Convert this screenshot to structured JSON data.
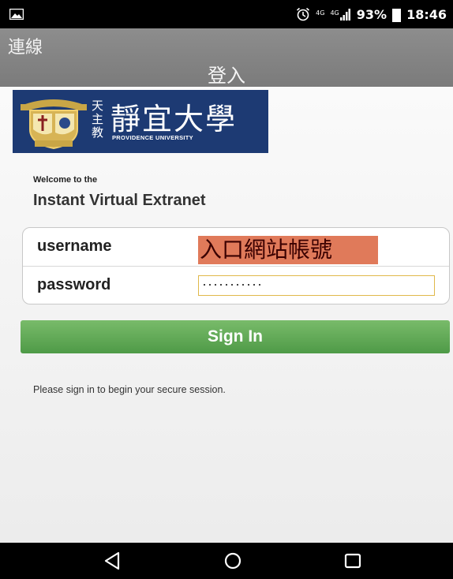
{
  "status_bar": {
    "network_1": "4G",
    "network_2": "4G",
    "battery_percent": "93%",
    "time": "18:46",
    "icons": [
      "picture-icon",
      "alarm-icon",
      "signal-icon",
      "battery-icon"
    ]
  },
  "app_bar": {
    "title": "連線",
    "page_title": "登入"
  },
  "logo": {
    "catholic": "天主教",
    "name_zh": "靜宜大學",
    "name_en": "PROVIDENCE UNIVERSITY"
  },
  "welcome": {
    "line1": "Welcome to the",
    "line2": "Instant Virtual Extranet"
  },
  "login": {
    "username_label": "username",
    "username_value": "入口網站帳號",
    "password_label": "password",
    "password_value": "···········"
  },
  "signin_button": "Sign In",
  "info_text": "Please sign in to begin your secure session.",
  "nav_bar": {
    "icons": [
      "back-icon",
      "home-icon",
      "recents-icon"
    ]
  },
  "colors": {
    "app_bar": "#838383",
    "logo_bg": "#1d3a73",
    "signin": "#5aa450",
    "username_highlight": "#e07a5a"
  }
}
